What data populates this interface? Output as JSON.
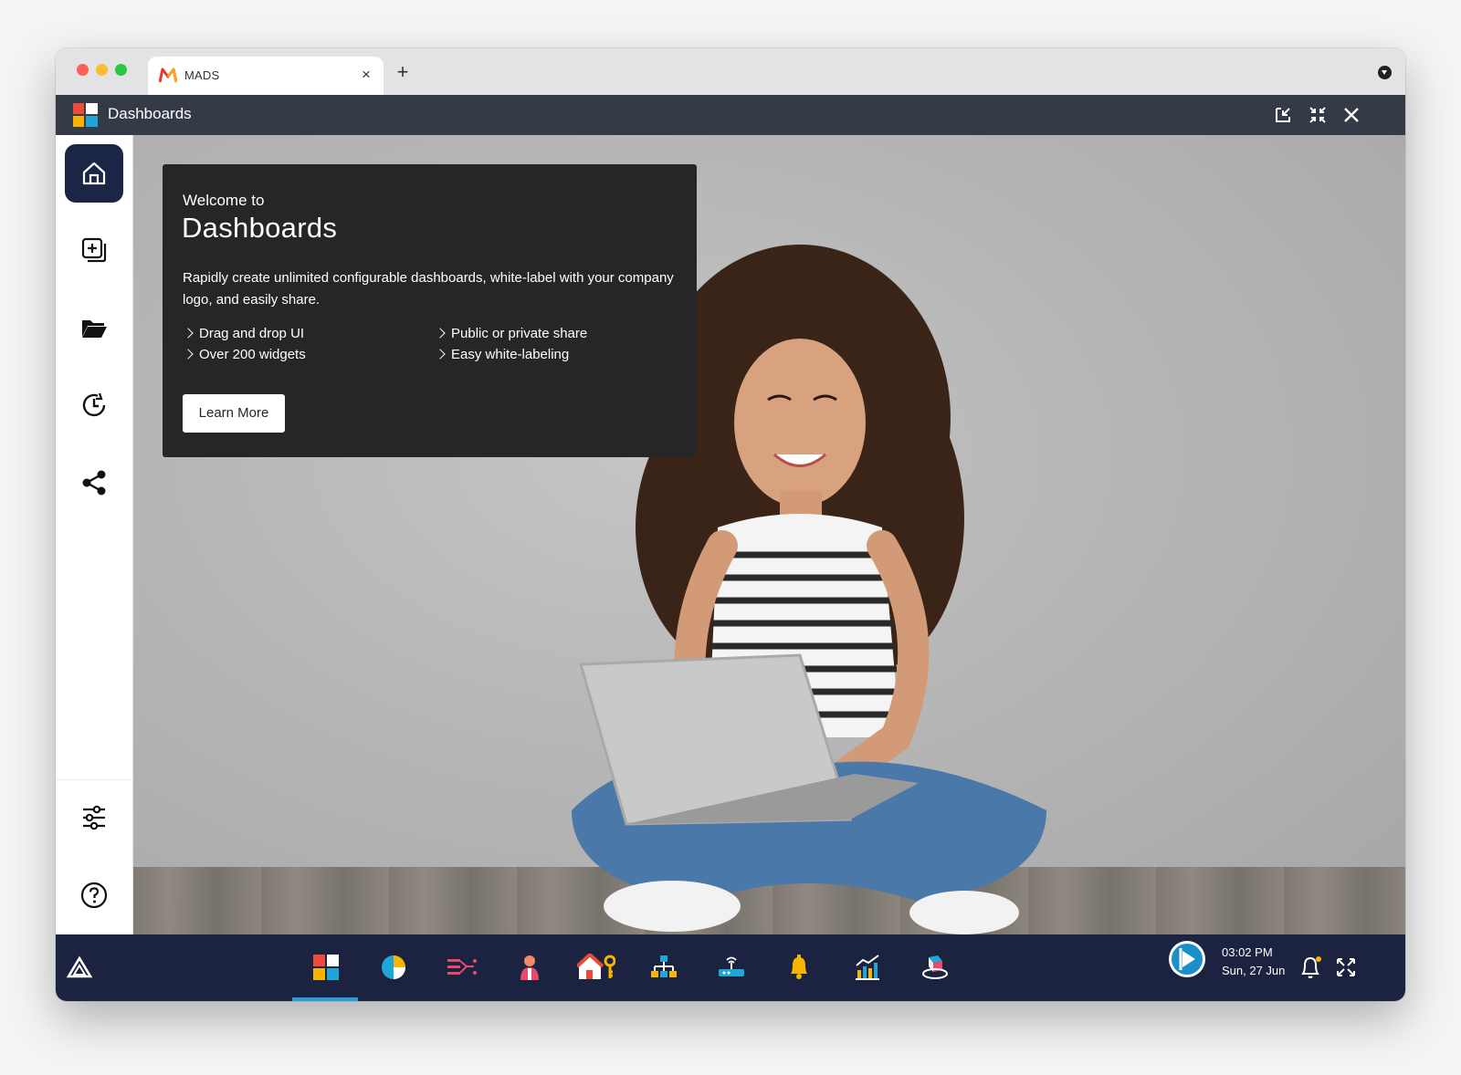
{
  "browser": {
    "tab_title": "MADS",
    "tab_close": "×",
    "new_tab": "+"
  },
  "app": {
    "title": "Dashboards"
  },
  "welcome": {
    "intro": "Welcome to",
    "heading": "Dashboards",
    "description": "Rapidly create unlimited configurable dashboards, white-label with your company logo, and easily share.",
    "features": [
      "Drag and drop UI",
      "Over 200 widgets",
      "Public or private share",
      "Easy white-labeling"
    ],
    "cta_label": "Learn More"
  },
  "sidebar": {
    "items": [
      {
        "icon": "home-icon",
        "active": true
      },
      {
        "icon": "add-dashboard-icon",
        "active": false
      },
      {
        "icon": "folder-open-icon",
        "active": false
      },
      {
        "icon": "history-icon",
        "active": false
      },
      {
        "icon": "share-icon",
        "active": false
      },
      {
        "icon": "settings-sliders-icon",
        "active": false
      },
      {
        "icon": "help-icon",
        "active": false
      }
    ]
  },
  "taskbar": {
    "apps": [
      "dashboards-app-icon",
      "pie-chart-app-icon",
      "flow-app-icon",
      "person-app-icon",
      "home-keys-app-icon",
      "org-chart-app-icon",
      "router-app-icon",
      "bell-app-icon",
      "growth-chart-app-icon",
      "cubes-app-icon"
    ],
    "time": "03:02 PM",
    "date": "Sun, 27 Jun"
  },
  "colors": {
    "appbar": "#343a46",
    "taskbar": "#1b2340",
    "active_sidebar": "#1b2545",
    "accent": "#2d9cdb"
  }
}
